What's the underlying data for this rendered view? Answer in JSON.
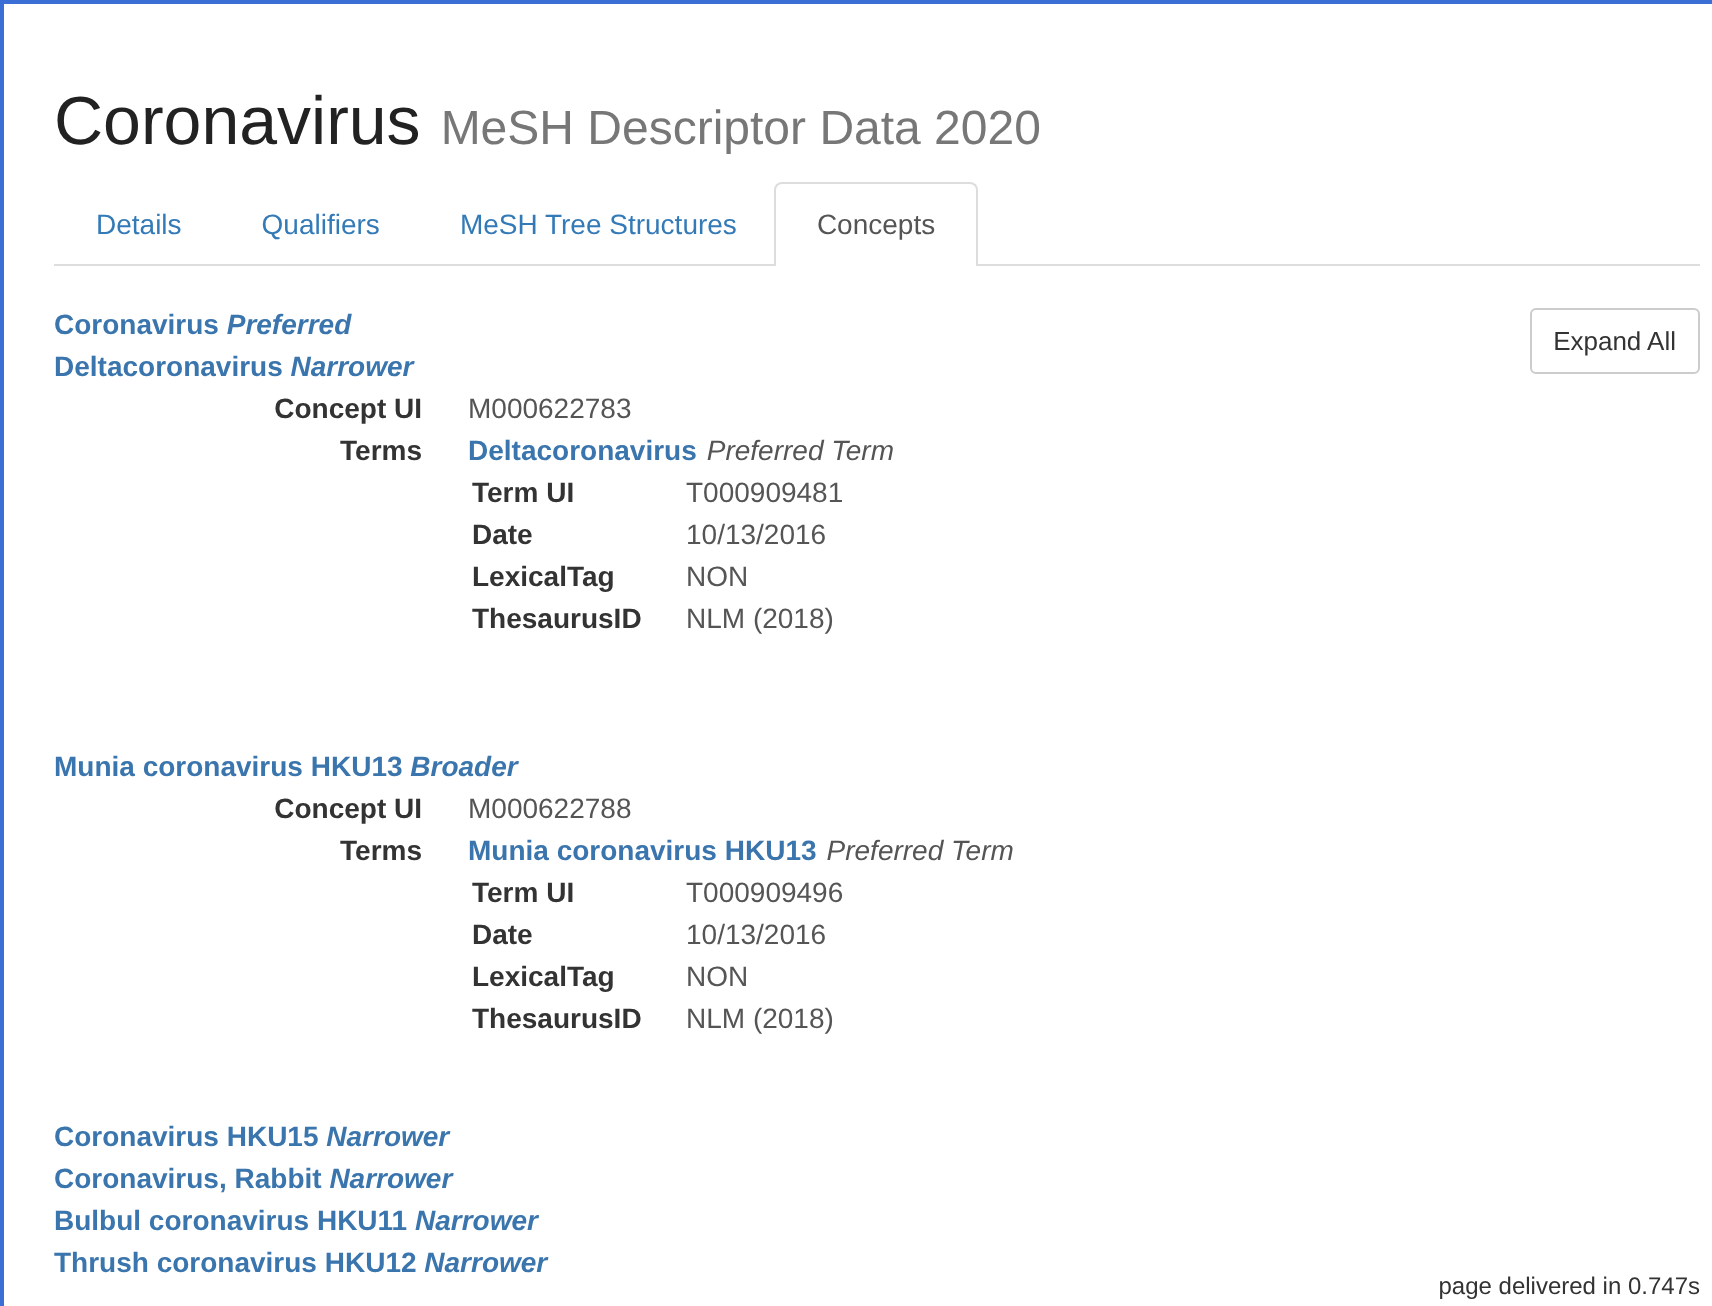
{
  "heading": {
    "title": "Coronavirus",
    "subtitle": "MeSH Descriptor Data 2020"
  },
  "tabs": [
    {
      "label": "Details",
      "selected": false
    },
    {
      "label": "Qualifiers",
      "selected": false
    },
    {
      "label": "MeSH Tree Structures",
      "selected": false
    },
    {
      "label": "Concepts",
      "selected": true
    }
  ],
  "expand_button": "Expand All",
  "concept_groups": [
    {
      "concepts": [
        {
          "text": "Coronavirus *Preferred*"
        },
        {
          "text": "Deltacoronavirus *Narrower*"
        }
      ],
      "detail": {
        "concept_ui_label": "Concept UI",
        "concept_ui": "M000622783",
        "terms_label": "Terms",
        "term_name": "Deltacoronavirus",
        "term_kind": "Preferred Term",
        "fields": [
          {
            "label": "Term UI",
            "value": "T000909481"
          },
          {
            "label": "Date",
            "value": "10/13/2016"
          },
          {
            "label": "LexicalTag",
            "value": "NON"
          },
          {
            "label": "ThesaurusID",
            "value": "NLM (2018)"
          }
        ]
      }
    },
    {
      "concepts": [
        {
          "text": "Munia coronavirus HKU13 *Broader*"
        }
      ],
      "detail": {
        "concept_ui_label": "Concept UI",
        "concept_ui": "M000622788",
        "terms_label": "Terms",
        "term_name": "Munia coronavirus HKU13",
        "term_kind": "Preferred Term",
        "fields": [
          {
            "label": "Term UI",
            "value": "T000909496"
          },
          {
            "label": "Date",
            "value": "10/13/2016"
          },
          {
            "label": "LexicalTag",
            "value": "NON"
          },
          {
            "label": "ThesaurusID",
            "value": "NLM (2018)"
          }
        ]
      }
    },
    {
      "concepts": [
        {
          "text": "Coronavirus HKU15 *Narrower*"
        },
        {
          "text": "Coronavirus, Rabbit *Narrower*"
        },
        {
          "text": "Bulbul coronavirus HKU11 *Narrower*"
        },
        {
          "text": "Thrush coronavirus HKU12 *Narrower*"
        }
      ]
    }
  ],
  "footer": "page delivered in 0.747s"
}
